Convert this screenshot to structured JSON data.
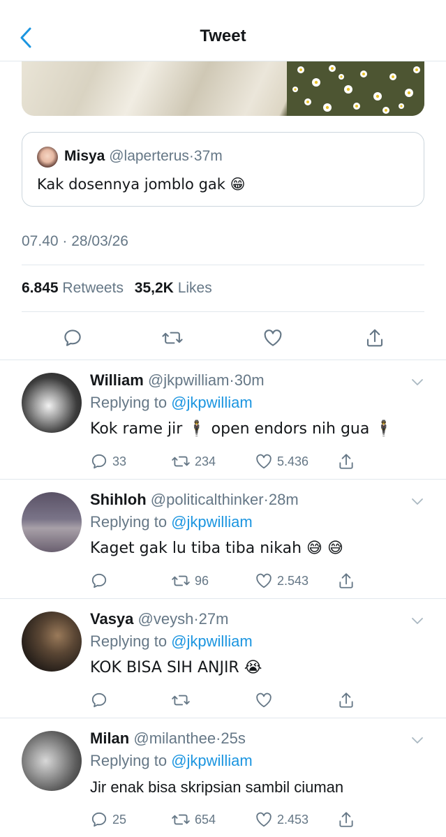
{
  "header": {
    "title": "Tweet"
  },
  "quoted_tweet": {
    "name": "Misya",
    "handle": "@laperterus",
    "time": "37m",
    "text": "Kak dosennya jomblo gak 😁"
  },
  "tweet": {
    "timestamp": "07.40 · 28/03/26",
    "retweets_count": "6.845",
    "retweets_label": "Retweets",
    "likes_count": "35,2K",
    "likes_label": "Likes"
  },
  "replies": [
    {
      "name": "William",
      "handle": "@jkpwilliam",
      "time": "30m",
      "replying_prefix": "Replying to",
      "replying_to": "@jkpwilliam",
      "text": "Kok rame jir 🕴 open endors nih gua 🕴",
      "reply_count": "33",
      "retweet_count": "234",
      "like_count": "5.436"
    },
    {
      "name": "Shihloh",
      "handle": "@politicalthinker",
      "time": "28m",
      "replying_prefix": "Replying to",
      "replying_to": "@jkpwilliam",
      "text": "Kaget gak lu tiba tiba nikah 😅 😅",
      "reply_count": "",
      "retweet_count": "96",
      "like_count": "2.543"
    },
    {
      "name": "Vasya",
      "handle": "@veysh",
      "time": "27m",
      "replying_prefix": "Replying to",
      "replying_to": "@jkpwilliam",
      "text": "KOK BISA SIH ANJIR 😭",
      "reply_count": "",
      "retweet_count": "",
      "like_count": ""
    },
    {
      "name": "Milan",
      "handle": "@milanthee",
      "time": "25s",
      "replying_prefix": "Replying to",
      "replying_to": "@jkpwilliam",
      "text": "Jir enak bisa skripsian sambil ciuman",
      "reply_count": "25",
      "retweet_count": "654",
      "like_count": "2.453"
    }
  ],
  "colors": {
    "accent": "#1b95e0",
    "text": "#14171a",
    "secondary": "#657786",
    "border": "#e1e8ed"
  },
  "icons": [
    "back-chevron-icon",
    "reply-icon",
    "retweet-icon",
    "like-icon",
    "share-icon",
    "chevron-down-icon"
  ]
}
